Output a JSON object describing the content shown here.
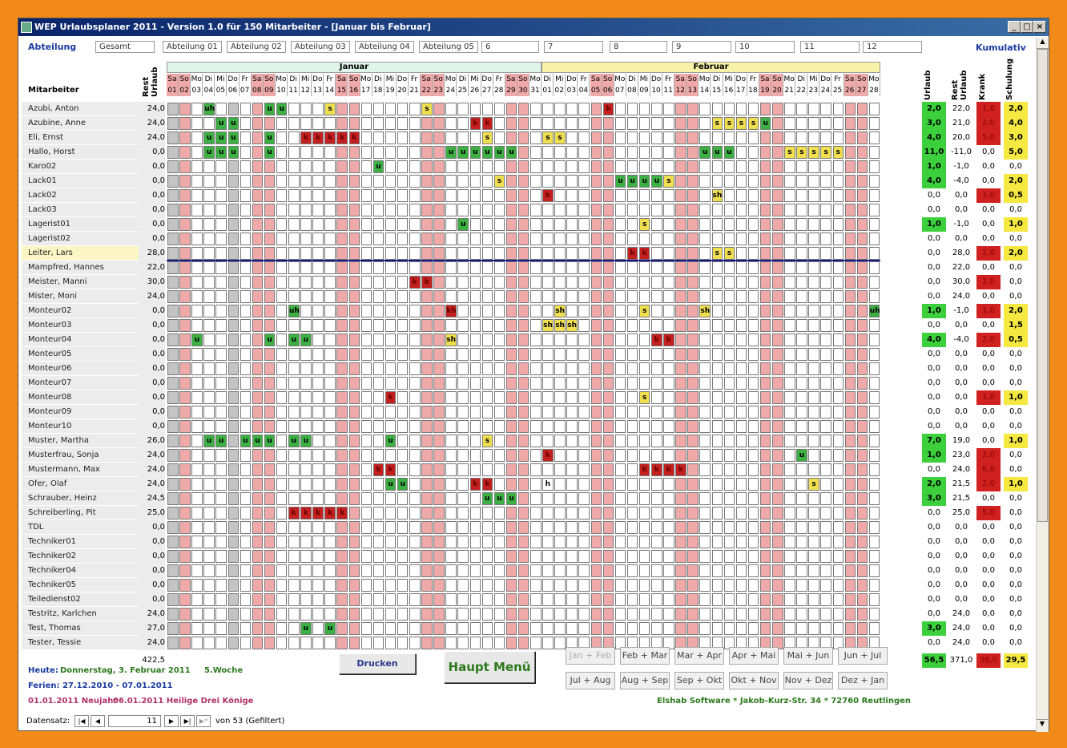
{
  "title": "WEP Urlaubsplaner 2011 - Version 1.0 für 150 Mitarbeiter - [Januar bis Februar]",
  "dept_label": "Abteilung",
  "dept_tabs": [
    "Gesamt",
    "Abteilung 01",
    "Abteilung 02",
    "Abteilung 03",
    "Abteilung 04",
    "Abteilung 05",
    "6",
    "7",
    "8",
    "9",
    "10",
    "11",
    "12"
  ],
  "kumulativ": "Kumulativ",
  "col_mitarbeiter": "Mitarbeiter",
  "col_resturlaub": "Rest Urlaub",
  "col_heads_right": [
    "Urlaub",
    "Rest Urlaub",
    "Krank",
    "Schulung"
  ],
  "months": [
    "Januar",
    "Februar"
  ],
  "days": {
    "jan": [
      "Sa",
      "So",
      "Mo",
      "Di",
      "Mi",
      "Do",
      "Fr",
      "Sa",
      "So",
      "Mo",
      "Di",
      "Mi",
      "Do",
      "Fr",
      "Sa",
      "So",
      "Mo",
      "Di",
      "Mi",
      "Do",
      "Fr",
      "Sa",
      "So",
      "Mo",
      "Di",
      "Mi",
      "Do",
      "Fr",
      "Sa",
      "So",
      "Mo"
    ],
    "feb": [
      "Di",
      "Mi",
      "Do",
      "Fr",
      "Sa",
      "So",
      "Mo",
      "Di",
      "Mi",
      "Do",
      "Fr",
      "Sa",
      "So",
      "Mo",
      "Di",
      "Mi",
      "Do",
      "Fr",
      "Sa",
      "So",
      "Mo",
      "Di",
      "Mi",
      "Do",
      "Fr",
      "Sa",
      "So",
      "Mo"
    ]
  },
  "employees": [
    {
      "name": "Azubi, Anton",
      "rest": "24,0",
      "u": "2,0",
      "r": "22,0",
      "k": "1,0",
      "s": "2,0",
      "marks": [
        [
          3,
          "uh"
        ],
        [
          8,
          "u"
        ],
        [
          9,
          "u"
        ],
        [
          13,
          "s"
        ],
        [
          21,
          "s"
        ],
        [
          36,
          "k"
        ]
      ]
    },
    {
      "name": "Azubine, Anne",
      "rest": "24,0",
      "u": "3,0",
      "r": "21,0",
      "k": "2,0",
      "s": "4,0",
      "marks": [
        [
          4,
          "u"
        ],
        [
          5,
          "u"
        ],
        [
          25,
          "k"
        ],
        [
          26,
          "k"
        ],
        [
          45,
          "s"
        ],
        [
          46,
          "s"
        ],
        [
          47,
          "s"
        ],
        [
          48,
          "s"
        ],
        [
          49,
          "u"
        ]
      ]
    },
    {
      "name": "Eli, Ernst",
      "rest": "24,0",
      "u": "4,0",
      "r": "20,0",
      "k": "5,0",
      "s": "3,0",
      "marks": [
        [
          3,
          "u"
        ],
        [
          4,
          "u"
        ],
        [
          5,
          "u"
        ],
        [
          8,
          "u"
        ],
        [
          11,
          "k"
        ],
        [
          12,
          "k"
        ],
        [
          13,
          "k"
        ],
        [
          14,
          "k"
        ],
        [
          15,
          "k"
        ],
        [
          26,
          "s"
        ],
        [
          31,
          "s"
        ],
        [
          32,
          "s"
        ]
      ]
    },
    {
      "name": "Hallo, Horst",
      "rest": "0,0",
      "u": "11,0",
      "r": "-11,0",
      "k": "0,0",
      "s": "5,0",
      "marks": [
        [
          3,
          "u"
        ],
        [
          4,
          "u"
        ],
        [
          5,
          "u"
        ],
        [
          8,
          "u"
        ],
        [
          23,
          "u"
        ],
        [
          24,
          "u"
        ],
        [
          25,
          "u"
        ],
        [
          26,
          "u"
        ],
        [
          27,
          "u"
        ],
        [
          28,
          "u"
        ],
        [
          44,
          "u"
        ],
        [
          45,
          "u"
        ],
        [
          46,
          "u"
        ],
        [
          51,
          "s"
        ],
        [
          52,
          "s"
        ],
        [
          53,
          "s"
        ],
        [
          54,
          "s"
        ],
        [
          55,
          "s"
        ]
      ]
    },
    {
      "name": "Karo02",
      "rest": "0,0",
      "u": "1,0",
      "r": "-1,0",
      "k": "0,0",
      "s": "0,0",
      "marks": [
        [
          17,
          "u"
        ]
      ]
    },
    {
      "name": "Lack01",
      "rest": "0,0",
      "u": "4,0",
      "r": "-4,0",
      "k": "0,0",
      "s": "2,0",
      "marks": [
        [
          27,
          "s"
        ],
        [
          37,
          "u"
        ],
        [
          38,
          "u"
        ],
        [
          39,
          "u"
        ],
        [
          40,
          "u"
        ],
        [
          41,
          "s"
        ]
      ]
    },
    {
      "name": "Lack02",
      "rest": "0,0",
      "u": "0,0",
      "r": "0,0",
      "k": "1,0",
      "s": "0,5",
      "marks": [
        [
          31,
          "k"
        ],
        [
          45,
          "sh"
        ]
      ]
    },
    {
      "name": "Lack03",
      "rest": "0,0",
      "u": "0,0",
      "r": "0,0",
      "k": "0,0",
      "s": "0,0",
      "marks": []
    },
    {
      "name": "Lagerist01",
      "rest": "0,0",
      "u": "1,0",
      "r": "-1,0",
      "k": "0,0",
      "s": "1,0",
      "marks": [
        [
          24,
          "u"
        ],
        [
          39,
          "s"
        ]
      ]
    },
    {
      "name": "Lagerist02",
      "rest": "0,0",
      "u": "0,0",
      "r": "0,0",
      "k": "0,0",
      "s": "0,0",
      "marks": []
    },
    {
      "name": "Leiter, Lars",
      "rest": "28,0",
      "u": "0,0",
      "r": "28,0",
      "k": "2,0",
      "s": "2,0",
      "marks": [
        [
          38,
          "k"
        ],
        [
          39,
          "k"
        ],
        [
          45,
          "s"
        ],
        [
          46,
          "s"
        ]
      ]
    },
    {
      "name": "Mampfred, Hannes",
      "rest": "22,0",
      "u": "0,0",
      "r": "22,0",
      "k": "0,0",
      "s": "0,0",
      "marks": []
    },
    {
      "name": "Meister, Manni",
      "rest": "30,0",
      "u": "0,0",
      "r": "30,0",
      "k": "2,0",
      "s": "0,0",
      "marks": [
        [
          20,
          "k"
        ],
        [
          21,
          "k"
        ]
      ]
    },
    {
      "name": "Mister, Moni",
      "rest": "24,0",
      "u": "0,0",
      "r": "24,0",
      "k": "0,0",
      "s": "0,0",
      "marks": []
    },
    {
      "name": "Monteur02",
      "rest": "0,0",
      "u": "1,0",
      "r": "-1,0",
      "k": "1,0",
      "s": "2,0",
      "marks": [
        [
          10,
          "uh"
        ],
        [
          23,
          "kh"
        ],
        [
          32,
          "sh"
        ],
        [
          39,
          "s"
        ],
        [
          44,
          "sh"
        ],
        [
          58,
          "uh"
        ]
      ]
    },
    {
      "name": "Monteur03",
      "rest": "0,0",
      "u": "0,0",
      "r": "0,0",
      "k": "0,0",
      "s": "1,5",
      "marks": [
        [
          31,
          "sh"
        ],
        [
          32,
          "sh"
        ],
        [
          33,
          "sh"
        ]
      ]
    },
    {
      "name": "Monteur04",
      "rest": "0,0",
      "u": "4,0",
      "r": "-4,0",
      "k": "2,0",
      "s": "0,5",
      "marks": [
        [
          2,
          "u"
        ],
        [
          8,
          "u"
        ],
        [
          10,
          "u"
        ],
        [
          11,
          "u"
        ],
        [
          23,
          "sh"
        ],
        [
          40,
          "k"
        ],
        [
          41,
          "k"
        ]
      ]
    },
    {
      "name": "Monteur05",
      "rest": "0,0",
      "u": "0,0",
      "r": "0,0",
      "k": "0,0",
      "s": "0,0",
      "marks": []
    },
    {
      "name": "Monteur06",
      "rest": "0,0",
      "u": "0,0",
      "r": "0,0",
      "k": "0,0",
      "s": "0,0",
      "marks": []
    },
    {
      "name": "Monteur07",
      "rest": "0,0",
      "u": "0,0",
      "r": "0,0",
      "k": "0,0",
      "s": "0,0",
      "marks": []
    },
    {
      "name": "Monteur08",
      "rest": "0,0",
      "u": "0,0",
      "r": "0,0",
      "k": "1,0",
      "s": "1,0",
      "marks": [
        [
          18,
          "k"
        ],
        [
          39,
          "s"
        ]
      ]
    },
    {
      "name": "Monteur09",
      "rest": "0,0",
      "u": "0,0",
      "r": "0,0",
      "k": "0,0",
      "s": "0,0",
      "marks": []
    },
    {
      "name": "Monteur10",
      "rest": "0,0",
      "u": "0,0",
      "r": "0,0",
      "k": "0,0",
      "s": "0,0",
      "marks": []
    },
    {
      "name": "Muster, Martha",
      "rest": "26,0",
      "u": "7,0",
      "r": "19,0",
      "k": "0,0",
      "s": "1,0",
      "marks": [
        [
          3,
          "u"
        ],
        [
          4,
          "u"
        ],
        [
          6,
          "u"
        ],
        [
          7,
          "u"
        ],
        [
          8,
          "u"
        ],
        [
          10,
          "u"
        ],
        [
          11,
          "u"
        ],
        [
          18,
          "u"
        ],
        [
          26,
          "s"
        ]
      ]
    },
    {
      "name": "Musterfrau, Sonja",
      "rest": "24,0",
      "u": "1,0",
      "r": "23,0",
      "k": "2,0",
      "s": "0,0",
      "marks": [
        [
          31,
          "k"
        ],
        [
          52,
          "u"
        ]
      ]
    },
    {
      "name": "Mustermann, Max",
      "rest": "24,0",
      "u": "0,0",
      "r": "24,0",
      "k": "6,0",
      "s": "0,0",
      "marks": [
        [
          17,
          "k"
        ],
        [
          18,
          "k"
        ],
        [
          39,
          "k"
        ],
        [
          40,
          "k"
        ],
        [
          41,
          "k"
        ],
        [
          42,
          "k"
        ]
      ]
    },
    {
      "name": "Ofer, Olaf",
      "rest": "24,0",
      "u": "2,0",
      "r": "21,5",
      "k": "2,0",
      "s": "1,0",
      "marks": [
        [
          18,
          "u"
        ],
        [
          19,
          "u"
        ],
        [
          25,
          "k"
        ],
        [
          26,
          "k"
        ],
        [
          31,
          "h"
        ],
        [
          53,
          "s"
        ]
      ]
    },
    {
      "name": "Schrauber, Heinz",
      "rest": "24,5",
      "u": "3,0",
      "r": "21,5",
      "k": "0,0",
      "s": "0,0",
      "marks": [
        [
          26,
          "u"
        ],
        [
          27,
          "u"
        ],
        [
          28,
          "u"
        ]
      ]
    },
    {
      "name": "Schreiberling, Pit",
      "rest": "25,0",
      "u": "0,0",
      "r": "25,0",
      "k": "5,0",
      "s": "0,0",
      "marks": [
        [
          10,
          "k"
        ],
        [
          11,
          "k"
        ],
        [
          12,
          "k"
        ],
        [
          13,
          "k"
        ],
        [
          14,
          "k"
        ]
      ]
    },
    {
      "name": "TDL",
      "rest": "0,0",
      "u": "0,0",
      "r": "0,0",
      "k": "0,0",
      "s": "0,0",
      "marks": []
    },
    {
      "name": "Techniker01",
      "rest": "0,0",
      "u": "0,0",
      "r": "0,0",
      "k": "0,0",
      "s": "0,0",
      "marks": []
    },
    {
      "name": "Techniker02",
      "rest": "0,0",
      "u": "0,0",
      "r": "0,0",
      "k": "0,0",
      "s": "0,0",
      "marks": []
    },
    {
      "name": "Techniker04",
      "rest": "0,0",
      "u": "0,0",
      "r": "0,0",
      "k": "0,0",
      "s": "0,0",
      "marks": []
    },
    {
      "name": "Techniker05",
      "rest": "0,0",
      "u": "0,0",
      "r": "0,0",
      "k": "0,0",
      "s": "0,0",
      "marks": []
    },
    {
      "name": "Teiledienst02",
      "rest": "0,0",
      "u": "0,0",
      "r": "0,0",
      "k": "0,0",
      "s": "0,0",
      "marks": []
    },
    {
      "name": "Testritz, Karlchen",
      "rest": "24,0",
      "u": "0,0",
      "r": "24,0",
      "k": "0,0",
      "s": "0,0",
      "marks": []
    },
    {
      "name": "Test, Thomas",
      "rest": "27,0",
      "u": "3,0",
      "r": "24,0",
      "k": "0,0",
      "s": "0,0",
      "marks": [
        [
          11,
          "u"
        ],
        [
          13,
          "u"
        ]
      ]
    },
    {
      "name": "Tester, Tessie",
      "rest": "24,0",
      "u": "0,0",
      "r": "24,0",
      "k": "0,0",
      "s": "0,0",
      "marks": []
    }
  ],
  "totals": {
    "rest": "422,5",
    "u": "56,5",
    "r": "371,0",
    "k": "36,0",
    "s": "29,5"
  },
  "print_btn": "Drucken",
  "main_menu_btn": "Haupt Menü",
  "nav_buttons": [
    "Jan + Feb",
    "Feb + Mar",
    "Mar + Apr",
    "Apr + Mai",
    "Mai + Jun",
    "Jun + Jul",
    "Jul + Aug",
    "Aug + Sep",
    "Sep + Okt",
    "Okt + Nov",
    "Nov + Dez",
    "Dez + Jan"
  ],
  "today_label": "Heute:",
  "today": "Donnerstag, 3. Februar 2011",
  "week": "5.Woche",
  "ferien": "Ferien: 27.12.2010 - 07.01.2011",
  "holiday1": "01.01.2011 Neujahr",
  "holiday2": "06.01.2011 Heilige Drei Könige",
  "company": "Elshab Software * Jakob-Kurz-Str. 34 * 72760 Reutlingen",
  "record_label": "Datensatz:",
  "record_current": "11",
  "record_total": "von 53 (Gefiltert)",
  "colors": {
    "urlaub": "#3cb043",
    "schulung": "#f0e050",
    "krank": "#c42020",
    "weekend": "#f0a9a9"
  }
}
